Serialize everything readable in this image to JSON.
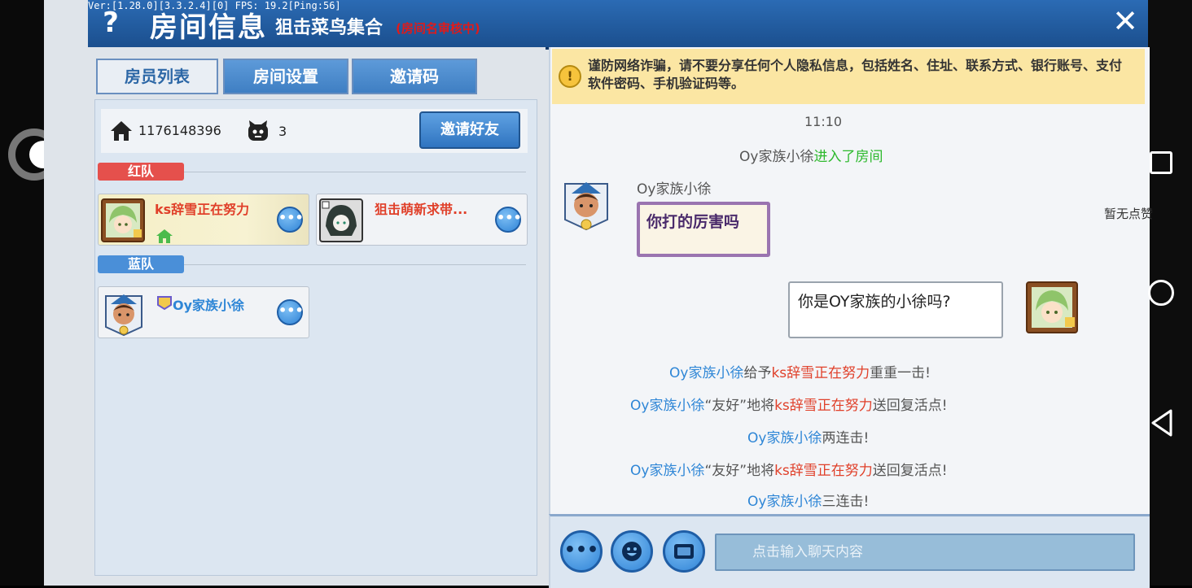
{
  "header": {
    "help": "?",
    "title": "房间信息",
    "room_name": "狙击菜鸟集合",
    "room_status": "(房间名审核中)",
    "close": "✕",
    "version": "Ver:[1.28.0][3.3.2.4][0] FPS: 19.2[Ping:56]"
  },
  "tabs": [
    {
      "label": "房员列表",
      "active": true
    },
    {
      "label": "房间设置",
      "active": false
    },
    {
      "label": "邀请码",
      "active": false
    }
  ],
  "room_info": {
    "room_id": "1176148396",
    "people_count": "3",
    "invite_button": "邀请好友"
  },
  "teams": {
    "red": {
      "label": "红队",
      "members": [
        {
          "name": "ks辞雪正在努力",
          "is_host": true
        },
        {
          "name": "狙击萌新求带..."
        }
      ]
    },
    "blue": {
      "label": "蓝队",
      "members": [
        {
          "name": "Oy家族小徐"
        }
      ]
    }
  },
  "chat": {
    "warning": "谨防网络诈骗，请不要分享任何个人隐私信息，包括姓名、住址、联系方式、银行账号、支付软件密码、手机验证码等。",
    "time": "11:10",
    "join": {
      "user": "Oy家族小徐",
      "action": "进入了房间"
    },
    "message1": {
      "sender": "Oy家族小徐",
      "text": "你打的厉害吗"
    },
    "message2": {
      "text": "你是OY家族的小徐吗?"
    },
    "no_likes": "暂无点赞",
    "events": {
      "e1": {
        "a": "Oy家族小徐",
        "b": "给予",
        "c": "ks辞雪正在努力",
        "d": "重重一击!"
      },
      "e2": {
        "a": "Oy家族小徐",
        "b": "“友好”地将",
        "c": "ks辞雪正在努力",
        "d": "送回复活点!"
      },
      "e3": {
        "a": "Oy家族小徐",
        "b": "两连击!"
      },
      "e4": {
        "a": "Oy家族小徐",
        "b": "“友好”地将",
        "c": "ks辞雪正在努力",
        "d": "送回复活点!"
      },
      "e5": {
        "a": "Oy家族小徐",
        "b": "三连击!"
      }
    },
    "input_placeholder": "点击输入聊天内容",
    "more_dots": "•••"
  }
}
